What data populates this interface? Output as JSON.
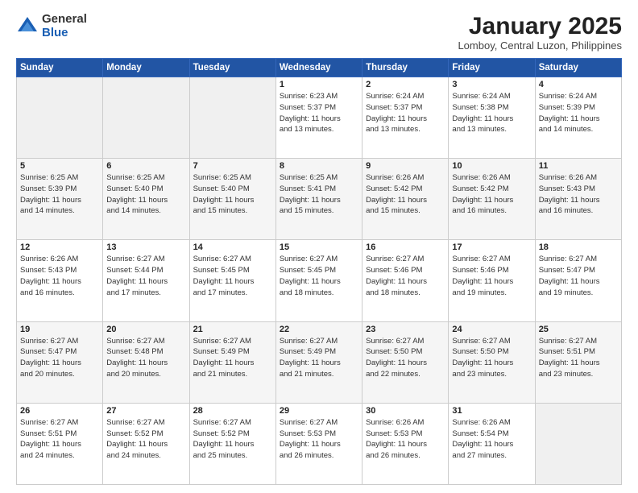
{
  "logo": {
    "general": "General",
    "blue": "Blue"
  },
  "title": "January 2025",
  "location": "Lomboy, Central Luzon, Philippines",
  "days_of_week": [
    "Sunday",
    "Monday",
    "Tuesday",
    "Wednesday",
    "Thursday",
    "Friday",
    "Saturday"
  ],
  "weeks": [
    [
      {
        "day": "",
        "info": ""
      },
      {
        "day": "",
        "info": ""
      },
      {
        "day": "",
        "info": ""
      },
      {
        "day": "1",
        "info": "Sunrise: 6:23 AM\nSunset: 5:37 PM\nDaylight: 11 hours\nand 13 minutes."
      },
      {
        "day": "2",
        "info": "Sunrise: 6:24 AM\nSunset: 5:37 PM\nDaylight: 11 hours\nand 13 minutes."
      },
      {
        "day": "3",
        "info": "Sunrise: 6:24 AM\nSunset: 5:38 PM\nDaylight: 11 hours\nand 13 minutes."
      },
      {
        "day": "4",
        "info": "Sunrise: 6:24 AM\nSunset: 5:39 PM\nDaylight: 11 hours\nand 14 minutes."
      }
    ],
    [
      {
        "day": "5",
        "info": "Sunrise: 6:25 AM\nSunset: 5:39 PM\nDaylight: 11 hours\nand 14 minutes."
      },
      {
        "day": "6",
        "info": "Sunrise: 6:25 AM\nSunset: 5:40 PM\nDaylight: 11 hours\nand 14 minutes."
      },
      {
        "day": "7",
        "info": "Sunrise: 6:25 AM\nSunset: 5:40 PM\nDaylight: 11 hours\nand 15 minutes."
      },
      {
        "day": "8",
        "info": "Sunrise: 6:25 AM\nSunset: 5:41 PM\nDaylight: 11 hours\nand 15 minutes."
      },
      {
        "day": "9",
        "info": "Sunrise: 6:26 AM\nSunset: 5:42 PM\nDaylight: 11 hours\nand 15 minutes."
      },
      {
        "day": "10",
        "info": "Sunrise: 6:26 AM\nSunset: 5:42 PM\nDaylight: 11 hours\nand 16 minutes."
      },
      {
        "day": "11",
        "info": "Sunrise: 6:26 AM\nSunset: 5:43 PM\nDaylight: 11 hours\nand 16 minutes."
      }
    ],
    [
      {
        "day": "12",
        "info": "Sunrise: 6:26 AM\nSunset: 5:43 PM\nDaylight: 11 hours\nand 16 minutes."
      },
      {
        "day": "13",
        "info": "Sunrise: 6:27 AM\nSunset: 5:44 PM\nDaylight: 11 hours\nand 17 minutes."
      },
      {
        "day": "14",
        "info": "Sunrise: 6:27 AM\nSunset: 5:45 PM\nDaylight: 11 hours\nand 17 minutes."
      },
      {
        "day": "15",
        "info": "Sunrise: 6:27 AM\nSunset: 5:45 PM\nDaylight: 11 hours\nand 18 minutes."
      },
      {
        "day": "16",
        "info": "Sunrise: 6:27 AM\nSunset: 5:46 PM\nDaylight: 11 hours\nand 18 minutes."
      },
      {
        "day": "17",
        "info": "Sunrise: 6:27 AM\nSunset: 5:46 PM\nDaylight: 11 hours\nand 19 minutes."
      },
      {
        "day": "18",
        "info": "Sunrise: 6:27 AM\nSunset: 5:47 PM\nDaylight: 11 hours\nand 19 minutes."
      }
    ],
    [
      {
        "day": "19",
        "info": "Sunrise: 6:27 AM\nSunset: 5:47 PM\nDaylight: 11 hours\nand 20 minutes."
      },
      {
        "day": "20",
        "info": "Sunrise: 6:27 AM\nSunset: 5:48 PM\nDaylight: 11 hours\nand 20 minutes."
      },
      {
        "day": "21",
        "info": "Sunrise: 6:27 AM\nSunset: 5:49 PM\nDaylight: 11 hours\nand 21 minutes."
      },
      {
        "day": "22",
        "info": "Sunrise: 6:27 AM\nSunset: 5:49 PM\nDaylight: 11 hours\nand 21 minutes."
      },
      {
        "day": "23",
        "info": "Sunrise: 6:27 AM\nSunset: 5:50 PM\nDaylight: 11 hours\nand 22 minutes."
      },
      {
        "day": "24",
        "info": "Sunrise: 6:27 AM\nSunset: 5:50 PM\nDaylight: 11 hours\nand 23 minutes."
      },
      {
        "day": "25",
        "info": "Sunrise: 6:27 AM\nSunset: 5:51 PM\nDaylight: 11 hours\nand 23 minutes."
      }
    ],
    [
      {
        "day": "26",
        "info": "Sunrise: 6:27 AM\nSunset: 5:51 PM\nDaylight: 11 hours\nand 24 minutes."
      },
      {
        "day": "27",
        "info": "Sunrise: 6:27 AM\nSunset: 5:52 PM\nDaylight: 11 hours\nand 24 minutes."
      },
      {
        "day": "28",
        "info": "Sunrise: 6:27 AM\nSunset: 5:52 PM\nDaylight: 11 hours\nand 25 minutes."
      },
      {
        "day": "29",
        "info": "Sunrise: 6:27 AM\nSunset: 5:53 PM\nDaylight: 11 hours\nand 26 minutes."
      },
      {
        "day": "30",
        "info": "Sunrise: 6:26 AM\nSunset: 5:53 PM\nDaylight: 11 hours\nand 26 minutes."
      },
      {
        "day": "31",
        "info": "Sunrise: 6:26 AM\nSunset: 5:54 PM\nDaylight: 11 hours\nand 27 minutes."
      },
      {
        "day": "",
        "info": ""
      }
    ]
  ]
}
